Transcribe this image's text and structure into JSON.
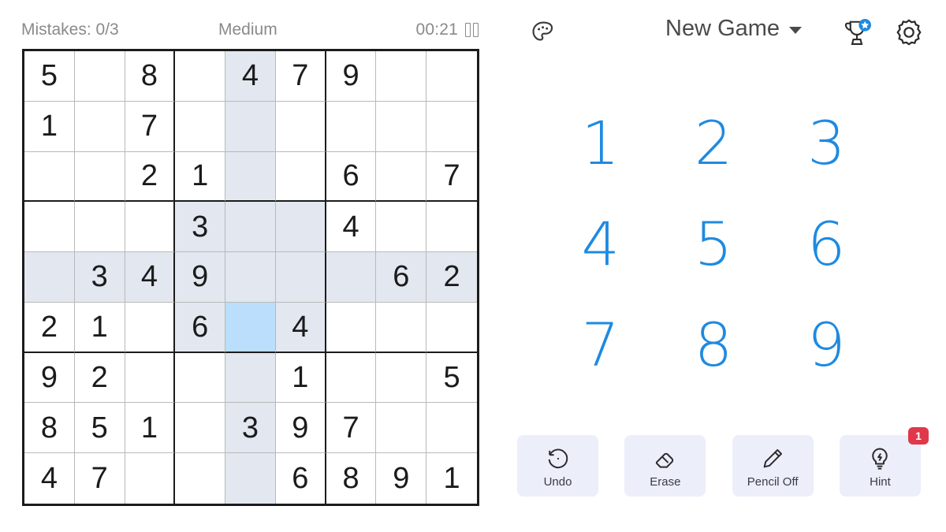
{
  "status": {
    "mistakes_label": "Mistakes: 0/3",
    "difficulty": "Medium",
    "timer": "00:21",
    "pause_icon": "pause-icon"
  },
  "board": {
    "rows": [
      [
        "5",
        "",
        "8",
        "",
        "4",
        "7",
        "9",
        "",
        ""
      ],
      [
        "1",
        "",
        "7",
        "",
        "",
        "",
        "",
        "",
        ""
      ],
      [
        "",
        "",
        "2",
        "1",
        "",
        "",
        "6",
        "",
        "7"
      ],
      [
        "",
        "",
        "",
        "3",
        "",
        "",
        "4",
        "",
        ""
      ],
      [
        "",
        "3",
        "4",
        "9",
        "",
        "",
        "",
        "6",
        "2"
      ],
      [
        "2",
        "1",
        "",
        "6",
        "",
        "4",
        "",
        "",
        ""
      ],
      [
        "9",
        "2",
        "",
        "",
        "",
        "1",
        "",
        "",
        "5"
      ],
      [
        "8",
        "5",
        "1",
        "",
        "3",
        "9",
        "7",
        "",
        ""
      ],
      [
        "4",
        "7",
        "",
        "",
        "",
        "6",
        "8",
        "9",
        "1"
      ]
    ],
    "selected": {
      "row": 6,
      "col": 5
    },
    "highlight": {
      "row": 5,
      "col": 5,
      "box_rows": [
        4,
        5,
        6
      ],
      "box_cols": [
        4,
        5,
        6
      ]
    },
    "colors": {
      "selected_cell": "#badefb",
      "peer_cell": "#e2e7f0",
      "grid_line": "#b9b9b9",
      "box_line": "#1c1c1c",
      "digit": "#1b1b1b"
    }
  },
  "top_controls": {
    "palette_icon": "palette-icon",
    "new_game_label": "New Game",
    "caret_icon": "chevron-down-icon",
    "trophy_icon": "trophy-icon",
    "trophy_badge_icon": "star-badge-icon",
    "settings_icon": "gear-icon"
  },
  "numpad": {
    "keys": [
      "1",
      "2",
      "3",
      "4",
      "5",
      "6",
      "7",
      "8",
      "9"
    ],
    "color": "#1f8ae0"
  },
  "actions": [
    {
      "label": "Undo",
      "icon": "undo-icon",
      "badge": null
    },
    {
      "label": "Erase",
      "icon": "eraser-icon",
      "badge": null
    },
    {
      "label": "Pencil Off",
      "icon": "pencil-icon",
      "badge": null
    },
    {
      "label": "Hint",
      "icon": "lightbulb-icon",
      "badge": "1"
    }
  ],
  "badge_color": "#e0384a"
}
